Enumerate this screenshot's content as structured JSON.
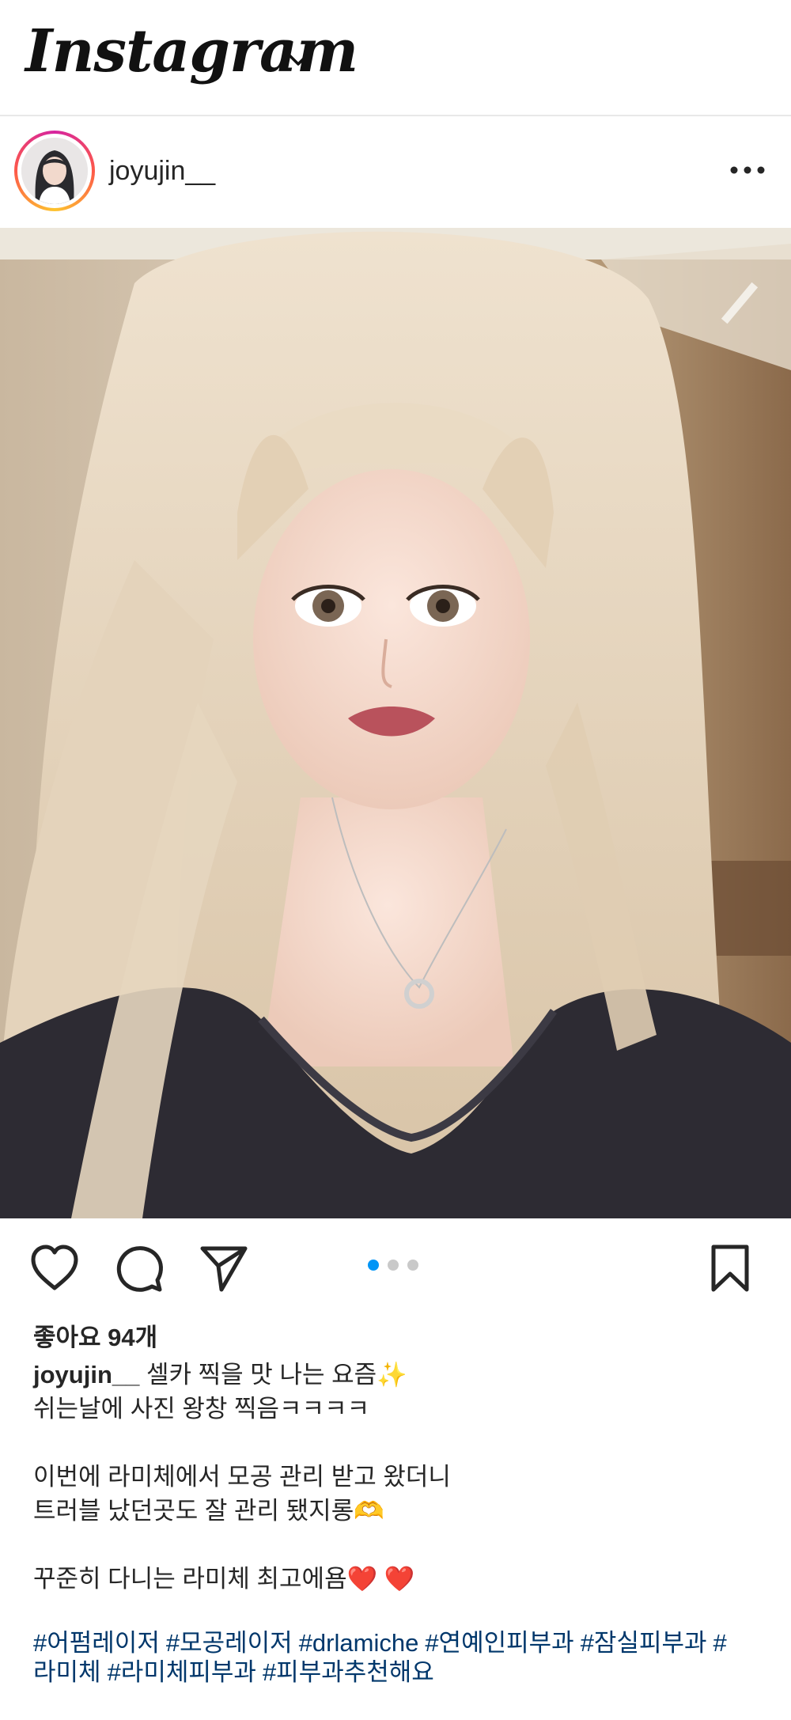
{
  "header": {
    "logo": "Instagram"
  },
  "post": {
    "username": "joyujin__",
    "likes": "좋아요 94개",
    "carousel": {
      "count": 3,
      "active": 0
    },
    "caption": {
      "username": "joyujin__",
      "first_line": "셀카 찍을 맛 나는 요즘✨",
      "line2": "쉬는날에 사진 왕창 찍음ㅋㅋㅋㅋ",
      "line3": "이번에 라미체에서 모공 관리 받고 왔더니",
      "line4": "트러블 났던곳도 잘 관리 됐지롱🫶",
      "line5": "꾸준히 다니는 라미체 최고에욤❤️ ❤️"
    },
    "hashtags": [
      "#어펌레이저",
      "#모공레이저",
      "#drlamiche",
      "#연예인피부과",
      "#잠실피부과",
      "#",
      "라미체",
      "#라미체피부과",
      "#피부과추천해요"
    ]
  },
  "colors": {
    "accent_blue": "#0095f6",
    "hashtag": "#00376b",
    "text": "#262626"
  }
}
